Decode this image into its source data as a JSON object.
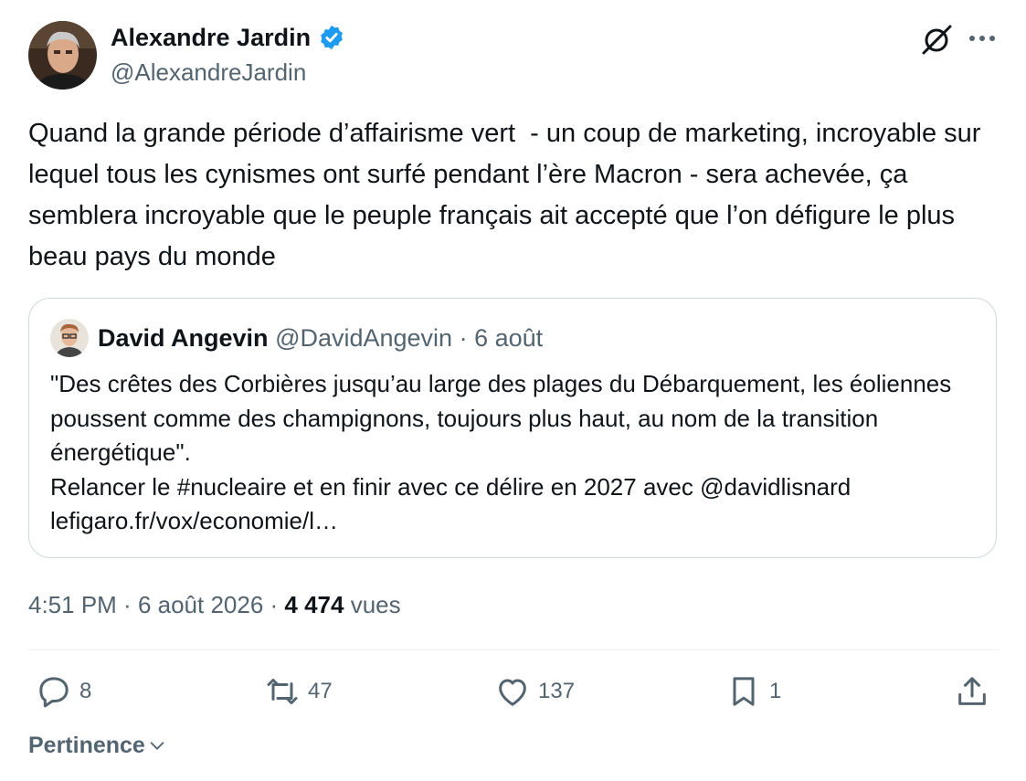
{
  "author": {
    "name": "Alexandre Jardin",
    "handle": "@AlexandreJardin"
  },
  "tweet": {
    "text": "Quand la grande période d’affairisme vert  - un coup de marketing, incroyable sur lequel tous les cynismes ont surfé pendant l’ère Macron - sera achevée, ça semblera incroyable que le peuple français ait accepté que l’on défigure le plus beau pays du monde"
  },
  "quote": {
    "name": "David Angevin",
    "handle": "@DavidAngevin",
    "separator": " · ",
    "date": "6 août",
    "text": "\"Des crêtes des Corbières jusqu’au large des plages du Débarquement, les éoliennes poussent comme des champignons, toujours plus haut, au nom de la transition énergétique\".\nRelancer le #nucleaire et en finir avec ce délire en 2027 avec @davidlisnard\nlefigaro.fr/vox/economie/l…"
  },
  "meta": {
    "time": "4:51 PM",
    "separator": " · ",
    "date": "6 août 2026",
    "views_count": "4 474",
    "views_label": " vues"
  },
  "actions": {
    "replies": "8",
    "retweets": "47",
    "likes": "137",
    "bookmarks": "1"
  },
  "sort": {
    "label": "Pertinence"
  },
  "colors": {
    "text": "#0f1419",
    "secondary": "#536471",
    "verified": "#1d9bf0",
    "border": "#cfd9de"
  },
  "icons": {
    "verified": "verified-badge-icon",
    "grok": "grok-icon",
    "more": "more-dots-icon",
    "reply": "reply-icon",
    "retweet": "retweet-icon",
    "like": "heart-icon",
    "bookmark": "bookmark-icon",
    "share": "share-icon",
    "chevron": "chevron-down-icon"
  }
}
